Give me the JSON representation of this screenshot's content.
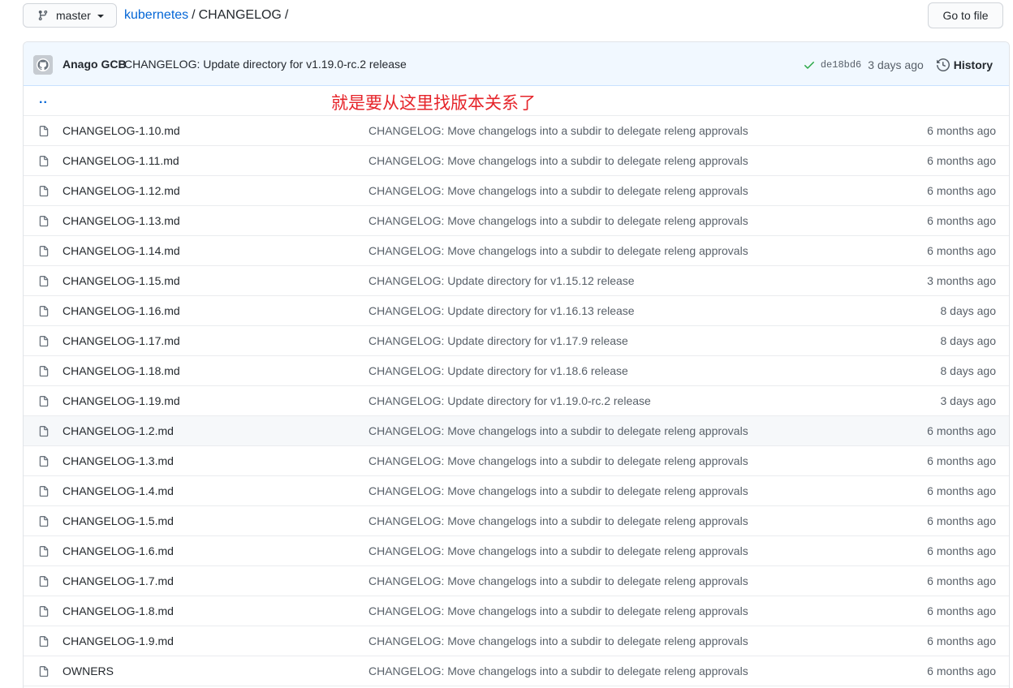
{
  "topbar": {
    "branch_label": "master",
    "breadcrumb_repo": "kubernetes",
    "breadcrumb_sep": "/",
    "breadcrumb_dir": "CHANGELOG",
    "breadcrumb_trail": "/",
    "goto_file_label": "Go to file"
  },
  "commit": {
    "author": "Anago GCB",
    "message": "CHANGELOG: Update directory for v1.19.0-rc.2 release",
    "sha": "de18bd6",
    "age": "3 days ago",
    "history_label": "History"
  },
  "parent": {
    "label": "..",
    "annotation": "就是要从这里找版本关系了"
  },
  "files": [
    {
      "name": "CHANGELOG-1.10.md",
      "commit": "CHANGELOG: Move changelogs into a subdir to delegate releng approvals",
      "age": "6 months ago"
    },
    {
      "name": "CHANGELOG-1.11.md",
      "commit": "CHANGELOG: Move changelogs into a subdir to delegate releng approvals",
      "age": "6 months ago"
    },
    {
      "name": "CHANGELOG-1.12.md",
      "commit": "CHANGELOG: Move changelogs into a subdir to delegate releng approvals",
      "age": "6 months ago"
    },
    {
      "name": "CHANGELOG-1.13.md",
      "commit": "CHANGELOG: Move changelogs into a subdir to delegate releng approvals",
      "age": "6 months ago"
    },
    {
      "name": "CHANGELOG-1.14.md",
      "commit": "CHANGELOG: Move changelogs into a subdir to delegate releng approvals",
      "age": "6 months ago"
    },
    {
      "name": "CHANGELOG-1.15.md",
      "commit": "CHANGELOG: Update directory for v1.15.12 release",
      "age": "3 months ago"
    },
    {
      "name": "CHANGELOG-1.16.md",
      "commit": "CHANGELOG: Update directory for v1.16.13 release",
      "age": "8 days ago"
    },
    {
      "name": "CHANGELOG-1.17.md",
      "commit": "CHANGELOG: Update directory for v1.17.9 release",
      "age": "8 days ago"
    },
    {
      "name": "CHANGELOG-1.18.md",
      "commit": "CHANGELOG: Update directory for v1.18.6 release",
      "age": "8 days ago"
    },
    {
      "name": "CHANGELOG-1.19.md",
      "commit": "CHANGELOG: Update directory for v1.19.0-rc.2 release",
      "age": "3 days ago"
    },
    {
      "name": "CHANGELOG-1.2.md",
      "commit": "CHANGELOG: Move changelogs into a subdir to delegate releng approvals",
      "age": "6 months ago"
    },
    {
      "name": "CHANGELOG-1.3.md",
      "commit": "CHANGELOG: Move changelogs into a subdir to delegate releng approvals",
      "age": "6 months ago"
    },
    {
      "name": "CHANGELOG-1.4.md",
      "commit": "CHANGELOG: Move changelogs into a subdir to delegate releng approvals",
      "age": "6 months ago"
    },
    {
      "name": "CHANGELOG-1.5.md",
      "commit": "CHANGELOG: Move changelogs into a subdir to delegate releng approvals",
      "age": "6 months ago"
    },
    {
      "name": "CHANGELOG-1.6.md",
      "commit": "CHANGELOG: Move changelogs into a subdir to delegate releng approvals",
      "age": "6 months ago"
    },
    {
      "name": "CHANGELOG-1.7.md",
      "commit": "CHANGELOG: Move changelogs into a subdir to delegate releng approvals",
      "age": "6 months ago"
    },
    {
      "name": "CHANGELOG-1.8.md",
      "commit": "CHANGELOG: Move changelogs into a subdir to delegate releng approvals",
      "age": "6 months ago"
    },
    {
      "name": "CHANGELOG-1.9.md",
      "commit": "CHANGELOG: Move changelogs into a subdir to delegate releng approvals",
      "age": "6 months ago"
    },
    {
      "name": "OWNERS",
      "commit": "CHANGELOG: Move changelogs into a subdir to delegate releng approvals",
      "age": "6 months ago"
    }
  ],
  "hovered_row": 10,
  "icons": {
    "branch": "git-branch-icon",
    "caret": "caret-down-icon",
    "avatar": "github-octocat-avatar",
    "check": "check-icon",
    "history": "history-clock-icon",
    "file": "file-icon"
  },
  "colors": {
    "link": "#0366d6",
    "commit_bar_bg": "#f1f8ff",
    "annotation": "#e6242a",
    "check": "#28a745"
  }
}
